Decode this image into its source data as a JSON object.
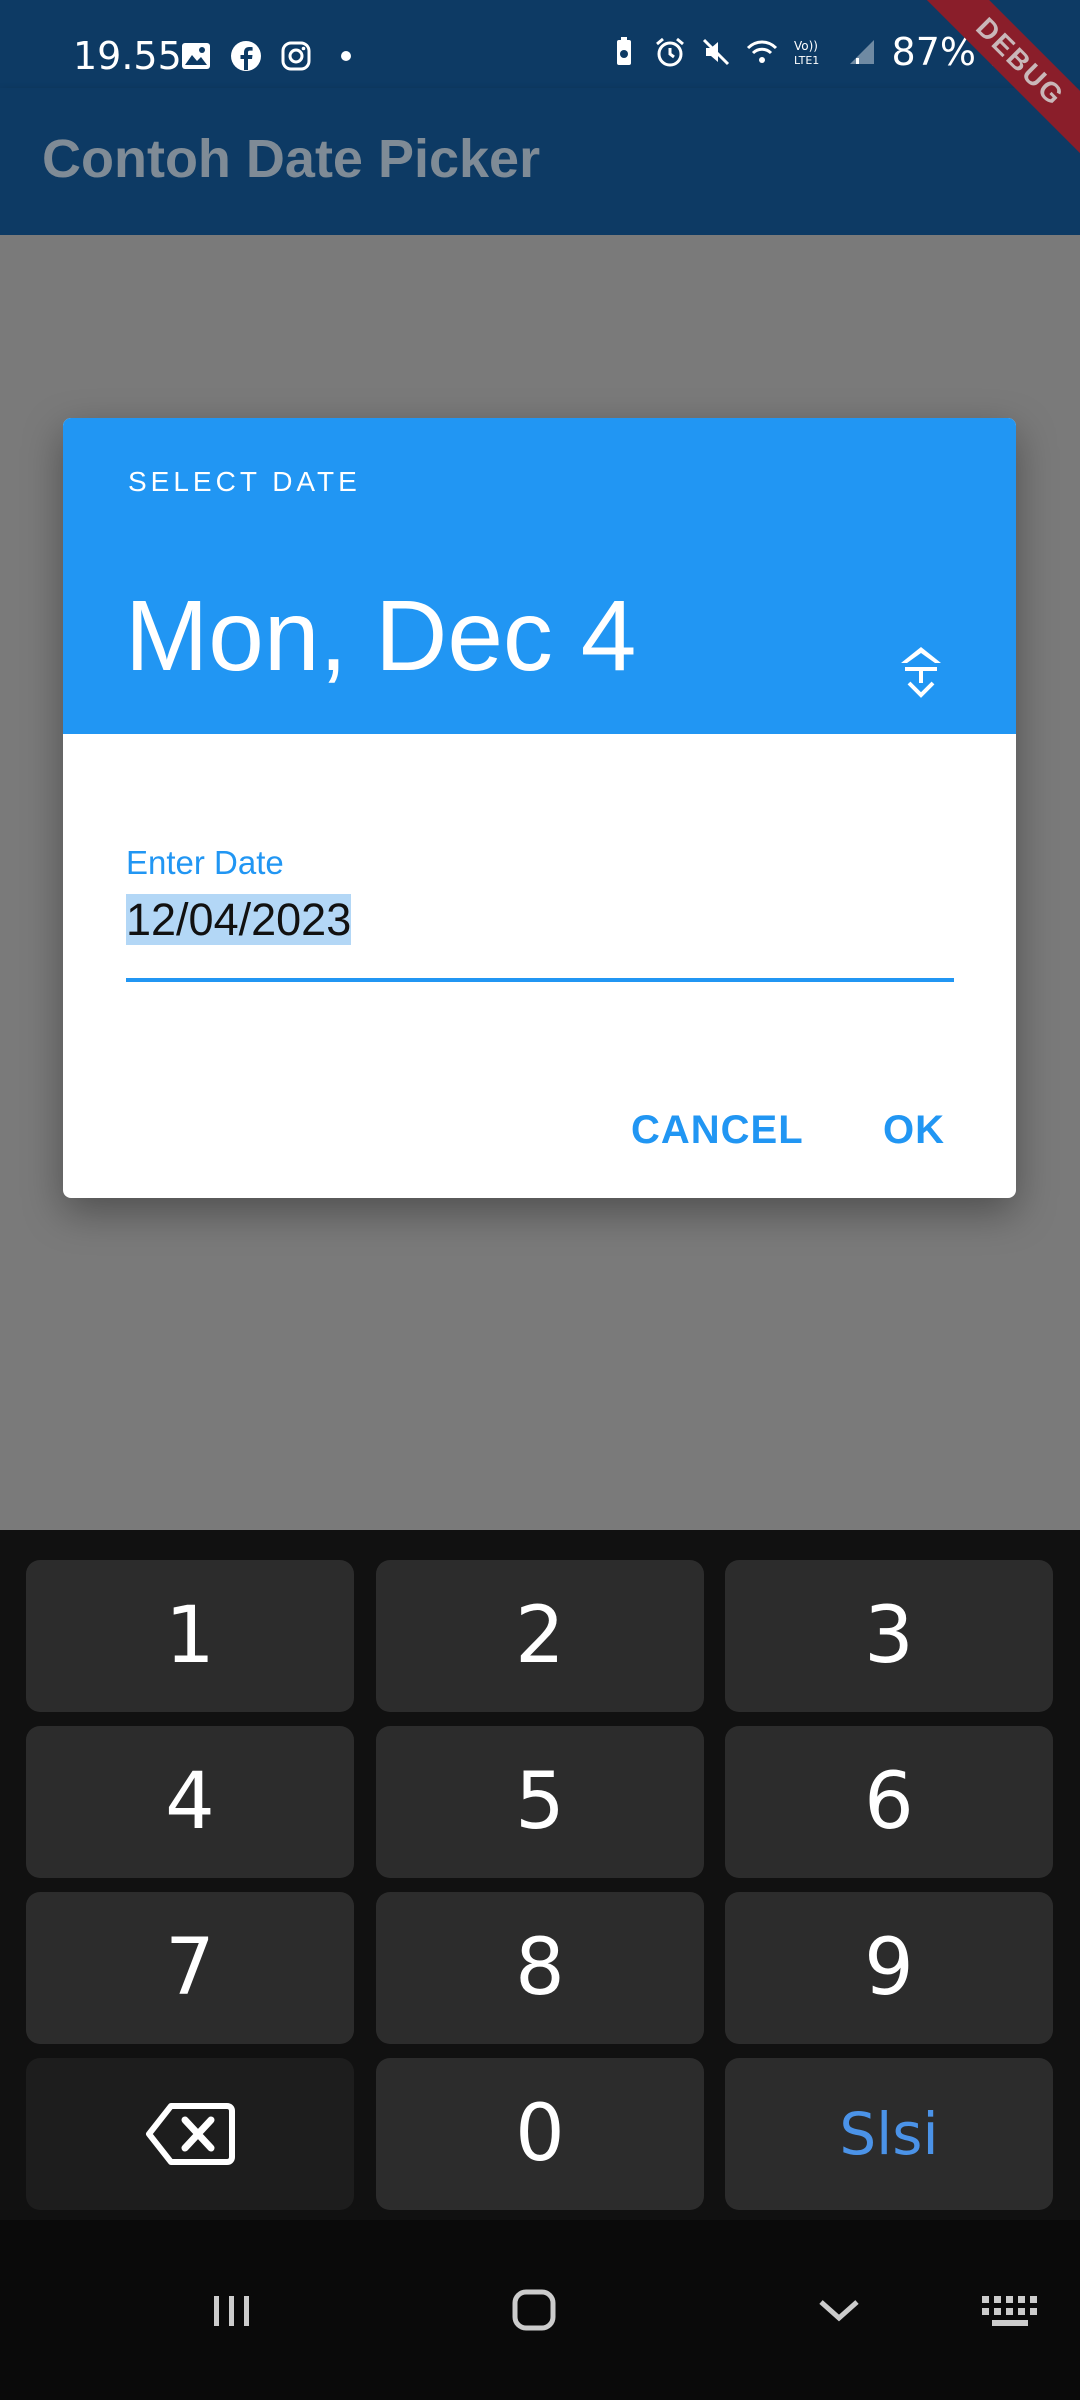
{
  "status_bar": {
    "time": "19.55",
    "battery": "87%",
    "left_icons": [
      "gallery-icon",
      "facebook-icon",
      "instagram-icon",
      "dot-icon"
    ],
    "right_icons": [
      "battery-saver-icon",
      "alarm-icon",
      "mute-icon",
      "wifi-icon",
      "volte-icon",
      "signal-icon",
      "charging-icon"
    ]
  },
  "debug_banner": "DEBUG",
  "app_bar": {
    "title": "Contoh Date Picker"
  },
  "dialog": {
    "header_label": "SELECT DATE",
    "selected_date": "Mon, Dec 4",
    "edit_icon": "calendar-toggle-icon",
    "field_label": "Enter Date",
    "field_value": "12/04/2023",
    "cancel_label": "CANCEL",
    "ok_label": "OK",
    "accent_color": "#2196f3"
  },
  "keyboard": {
    "keys": [
      "1",
      "2",
      "3",
      "4",
      "5",
      "6",
      "7",
      "8",
      "9",
      "",
      "0",
      "Slsi"
    ],
    "backspace_icon": "backspace-icon"
  },
  "nav_bar": {
    "icons": [
      "recents-icon",
      "home-icon",
      "back-chevron-icon",
      "keyboard-icon"
    ]
  }
}
